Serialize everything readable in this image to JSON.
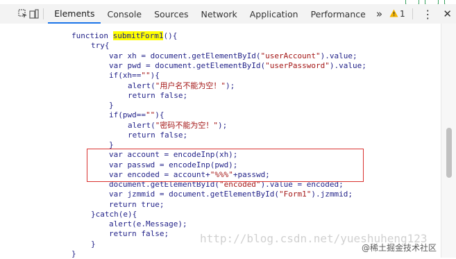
{
  "tabs": [
    {
      "label": "Elements",
      "active": true
    },
    {
      "label": "Console"
    },
    {
      "label": "Sources"
    },
    {
      "label": "Network"
    },
    {
      "label": "Application"
    },
    {
      "label": "Performance"
    }
  ],
  "toolbar": {
    "more_glyph": "»",
    "warning_count": "1",
    "kebab_glyph": "⋮",
    "close_glyph": "✕"
  },
  "code": {
    "line1_kw": "function ",
    "line1_fn": "submitForm1",
    "line1_rest": "(){",
    "line2": "try{",
    "line3_a": "var xh = document.getElementById(",
    "line3_s": "\"userAccount\"",
    "line3_b": ").value;",
    "line4_a": "var pwd = document.getElementById(",
    "line4_s": "\"userPassword\"",
    "line4_b": ").value;",
    "line5_a": "if(xh==",
    "line5_s": "\"\"",
    "line5_b": "){",
    "line6_a": "alert(",
    "line6_s": "\"用户名不能为空！\"",
    "line6_b": ");",
    "line7": "return false;",
    "line8": "}",
    "line9_a": "if(pwd==",
    "line9_s": "\"\"",
    "line9_b": "){",
    "line10_a": "alert(",
    "line10_s": "\"密码不能为空！\"",
    "line10_b": ");",
    "line11": "return false;",
    "line12": "}",
    "line13": "var account = encodeInp(xh);",
    "line14": "var passwd = encodeInp(pwd);",
    "line15_a": "var encoded = account+",
    "line15_s": "\"%%%\"",
    "line15_b": "+passwd;",
    "line16_a": "document.getElementById(",
    "line16_s": "\"encoded\"",
    "line16_b": ").value = encoded;",
    "line17_a": "var jzmmid = document.getElementById(",
    "line17_s": "\"Form1\"",
    "line17_b": ").jzmmid;",
    "line18": "return true;",
    "line19": "}catch(e){",
    "line20": "alert(e.Message);",
    "line21": "return false;",
    "line22": "}",
    "line23": "}"
  },
  "watermark": {
    "url": "http://blog.csdn.net/yueshuheng123",
    "site": "@稀土掘金技术社区"
  },
  "colors": {
    "keyword": "#1f1f87",
    "string": "#a31515",
    "highlight": "#ffff00",
    "annotation_box": "#d9302e",
    "active_tab_underline": "#1a73e8"
  }
}
